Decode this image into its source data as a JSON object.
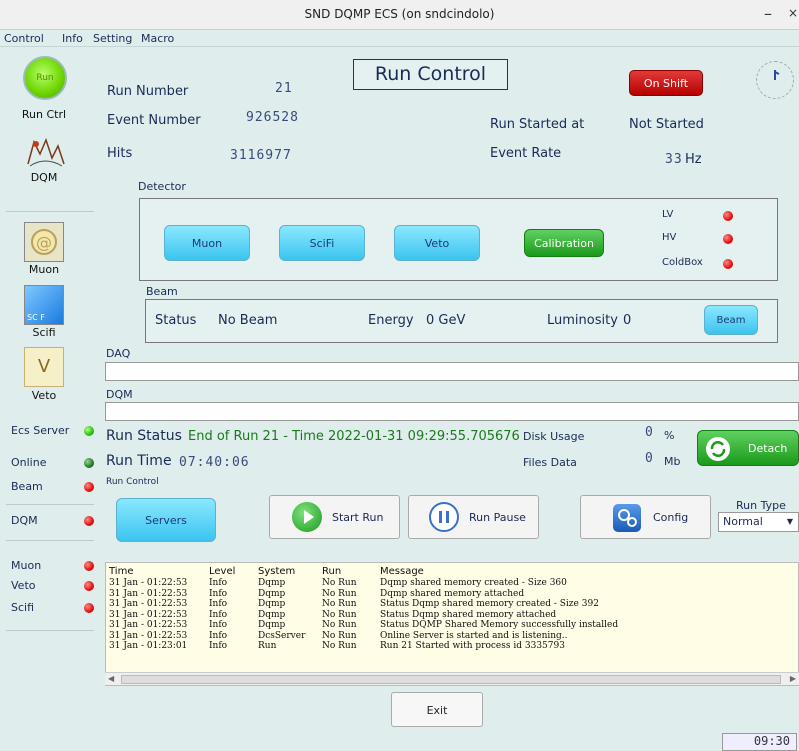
{
  "window": {
    "title": "SND DQMP ECS (on sndcindolo)",
    "min": "–",
    "close": "×"
  },
  "menu": [
    "Control",
    "Info",
    "Setting",
    "Macro"
  ],
  "sidebar": {
    "run_btn": "Run",
    "run_ctrl": "Run Ctrl",
    "dqm": "DQM",
    "muon": "Muon",
    "scifi": "Scifi",
    "scifi_icon_text": "SC F",
    "veto": "Veto",
    "veto_icon_text": "V"
  },
  "status": [
    {
      "label": "Ecs Server",
      "state": "green"
    },
    {
      "label": "Online",
      "state": "dark"
    },
    {
      "label": "Beam",
      "state": "red"
    },
    {
      "label": "DQM",
      "state": "red"
    },
    {
      "label": "Muon",
      "state": "red"
    },
    {
      "label": "Veto",
      "state": "red"
    },
    {
      "label": "Scifi",
      "state": "red"
    }
  ],
  "main": {
    "run_number_label": "Run Number",
    "run_number": "21",
    "event_number_label": "Event Number",
    "event_number": "926528",
    "hits_label": "Hits",
    "hits": "3116977",
    "title": "Run Control",
    "on_shift": "On Shift",
    "run_started_label": "Run Started at",
    "run_started": "Not Started",
    "event_rate_label": "Event Rate",
    "event_rate": "33",
    "event_rate_unit": "Hz"
  },
  "detector": {
    "label": "Detector",
    "buttons": [
      "Muon",
      "SciFi",
      "Veto"
    ],
    "calibration": "Calibration",
    "lv": "LV",
    "hv": "HV",
    "coldbox": "ColdBox"
  },
  "beam": {
    "label": "Beam",
    "status_label": "Status",
    "status": "No Beam",
    "energy_label": "Energy",
    "energy": "0 GeV",
    "lumi_label": "Luminosity",
    "lumi": "0",
    "button": "Beam"
  },
  "daq_label": "DAQ",
  "dqm_label": "DQM",
  "run_status": {
    "label": "Run Status",
    "text": "End of Run 21 - Time 2022-01-31 09:29:55.705676",
    "run_time_label": "Run Time",
    "run_time": "07:40:06",
    "disk_label": "Disk Usage",
    "disk_value": "0",
    "disk_unit": "%",
    "files_label": "Files Data",
    "files_value": "0",
    "files_unit": "Mb",
    "detach": "Detach"
  },
  "run_control": {
    "label": "Run Control",
    "servers": "Servers",
    "start": "Start Run",
    "pause": "Run Pause",
    "config": "Config",
    "run_type_label": "Run Type",
    "run_type": "Normal"
  },
  "log": {
    "headers": [
      "Time",
      "Level",
      "System",
      "Run",
      "Message"
    ],
    "rows": [
      [
        "31 Jan - 01:22:53",
        "Info",
        "Dqmp",
        "No Run",
        "Dqmp shared memory created - Size 360"
      ],
      [
        "31 Jan - 01:22:53",
        "Info",
        "Dqmp",
        "No Run",
        "Dqmp shared memory attached"
      ],
      [
        "31 Jan - 01:22:53",
        "Info",
        "Dqmp",
        "No Run",
        "Status Dqmp shared memory created - Size 392"
      ],
      [
        "31 Jan - 01:22:53",
        "Info",
        "Dqmp",
        "No Run",
        "Status Dqmp shared memory attached"
      ],
      [
        "31 Jan - 01:22:53",
        "Info",
        "Dqmp",
        "No Run",
        "Status DQMP Shared Memory successfully installed"
      ],
      [
        "31 Jan - 01:22:53",
        "Info",
        "DcsServer",
        "No Run",
        "Online Server is started and is listening.."
      ],
      [
        "31 Jan - 01:23:01",
        "Info",
        "Run",
        "No Run",
        "Run 21 Started with process id 3335793"
      ]
    ]
  },
  "exit": "Exit",
  "clock": "09:30"
}
